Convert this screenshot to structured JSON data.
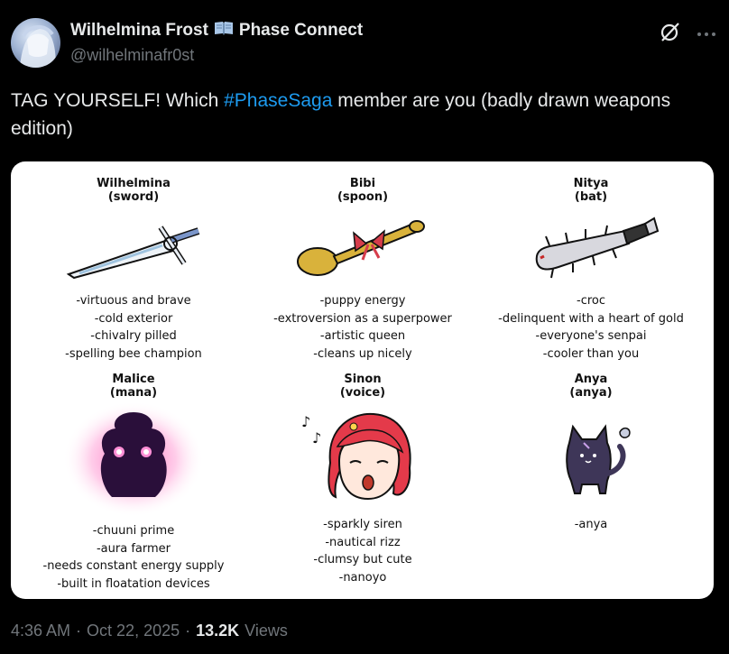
{
  "author": {
    "name": "Wilhelmina Frost",
    "name_suffix": "Phase Connect",
    "handle": "@wilhelminafr0st"
  },
  "tweet": {
    "text_before": "TAG YOURSELF! Which ",
    "hashtag": "#PhaseSaga",
    "text_after": " member are you (badly drawn weapons edition)"
  },
  "image": {
    "cells": [
      {
        "name": "Wilhelmina",
        "sub": "(sword)",
        "icon": "sword-icon",
        "traits": [
          "-virtuous and brave",
          "-cold exterior",
          "-chivalry pilled",
          "-spelling bee champion"
        ]
      },
      {
        "name": "Bibi",
        "sub": "(spoon)",
        "icon": "spoon-icon",
        "traits": [
          "-puppy energy",
          "-extroversion as a superpower",
          "-artistic queen",
          "-cleans up nicely"
        ]
      },
      {
        "name": "Nitya",
        "sub": "(bat)",
        "icon": "spiked-bat-icon",
        "traits": [
          "-croc",
          "-delinquent with a heart of gold",
          "-everyone's senpai",
          "-cooler than you"
        ]
      },
      {
        "name": "Malice",
        "sub": "(mana)",
        "icon": "mana-shadow-icon",
        "traits": [
          "-chuuni prime",
          "-aura farmer",
          "-needs constant energy supply",
          "-built in floatation devices"
        ]
      },
      {
        "name": "Sinon",
        "sub": "(voice)",
        "icon": "singing-girl-icon",
        "traits": [
          "-sparkly siren",
          "-nautical rizz",
          "-clumsy but cute",
          "-nanoyo"
        ]
      },
      {
        "name": "Anya",
        "sub": "(anya)",
        "icon": "cat-icon",
        "traits": [
          "-anya"
        ]
      }
    ]
  },
  "meta": {
    "time": "4:36 AM",
    "separator": "·",
    "date": "Oct 22, 2025",
    "views_count": "13.2K",
    "views_label": "Views"
  },
  "colors": {
    "background": "#000000",
    "text": "#e7e9ea",
    "muted": "#71767b",
    "link": "#1d9bf0"
  }
}
